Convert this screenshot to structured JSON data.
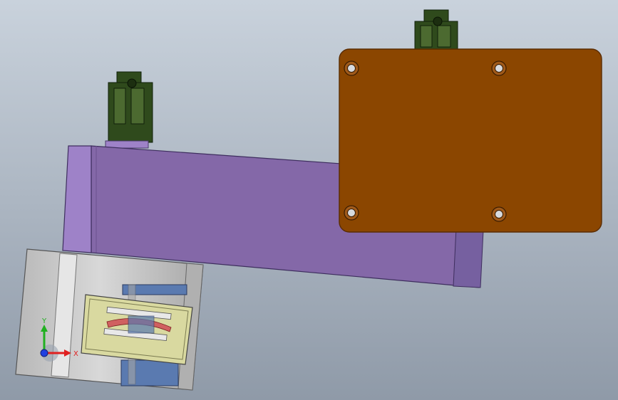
{
  "view": {
    "background_top": "#c9d2dc",
    "background_bottom": "#8f9aa8"
  },
  "parts": {
    "arm_color": "#8468a8",
    "arm_end_color": "#9e82c8",
    "plate_color": "#8b4600",
    "plate_edge_color": "#5a2c00",
    "housing_color": "#c9c9c9",
    "motor_color": "#2f4a1c",
    "panel_color": "#d9d9a0",
    "slot_color": "#5a7ab0",
    "accent_red": "#d06060"
  },
  "triad": {
    "x_label": "X",
    "y_label": "Y",
    "x_color": "#e02020",
    "y_color": "#20b020",
    "z_color": "#2040e0"
  }
}
